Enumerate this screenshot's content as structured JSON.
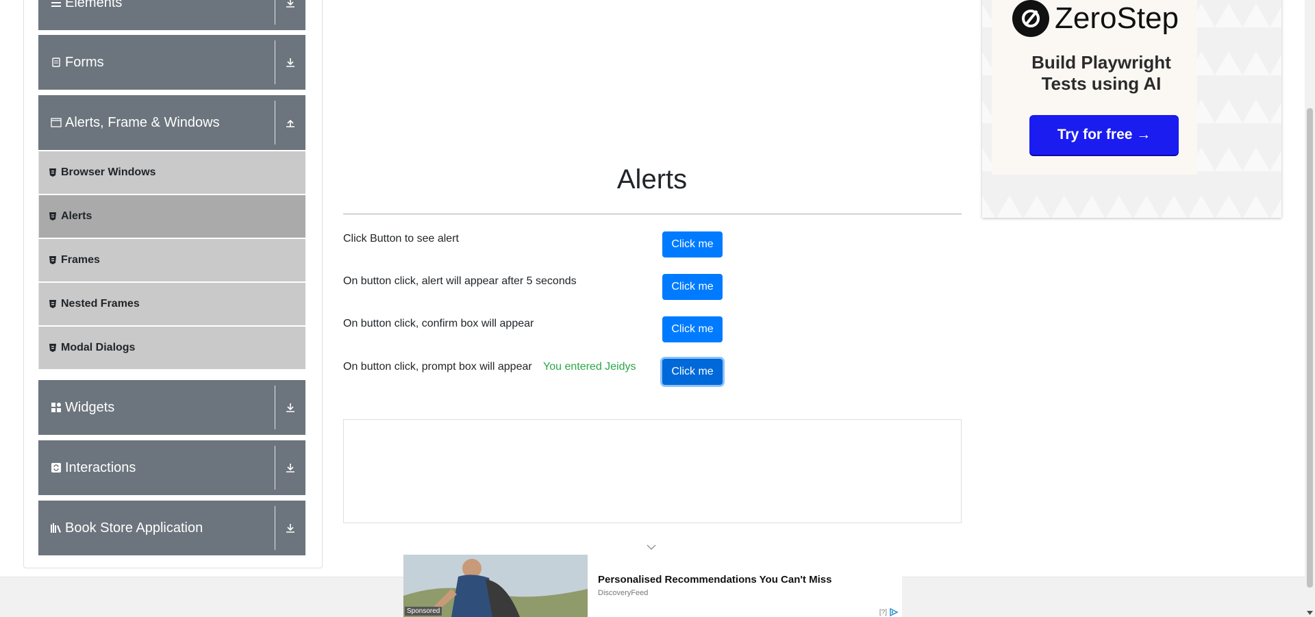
{
  "sidebar": {
    "groups": [
      {
        "label": "Elements",
        "icon": "list-icon",
        "arrow": "down"
      },
      {
        "label": "Forms",
        "icon": "document-icon",
        "arrow": "down"
      },
      {
        "label": "Alerts, Frame & Windows",
        "icon": "window-icon",
        "arrow": "up"
      },
      {
        "label": "Widgets",
        "icon": "grid-icon",
        "arrow": "down"
      },
      {
        "label": "Interactions",
        "icon": "refresh-icon",
        "arrow": "down"
      },
      {
        "label": "Book Store Application",
        "icon": "books-icon",
        "arrow": "down"
      }
    ],
    "items": [
      {
        "label": "Browser Windows"
      },
      {
        "label": "Alerts"
      },
      {
        "label": "Frames"
      },
      {
        "label": "Nested Frames"
      },
      {
        "label": "Modal Dialogs"
      }
    ],
    "active_item": "Alerts"
  },
  "main": {
    "title": "Alerts",
    "rows": [
      {
        "label": "Click Button to see alert",
        "button": "Click me"
      },
      {
        "label": "On button click, alert will appear after 5 seconds",
        "button": "Click me"
      },
      {
        "label": "On button click, confirm box will appear",
        "button": "Click me"
      },
      {
        "label": "On button click, prompt box will appear",
        "button": "Click me",
        "result": "You entered Jeidys"
      }
    ]
  },
  "ad_right": {
    "brand": "ZeroStep",
    "tagline": "Build Playwright Tests using AI",
    "cta": "Try for free →",
    "cta_color": "#1a1cf0"
  },
  "ad_bottom": {
    "title": "Personalised Recommendations You Can't Miss",
    "source": "DiscoveryFeed",
    "sponsored": "Sponsored",
    "help": "[?]"
  },
  "colors": {
    "sidebar_group": "#6c757d",
    "menu_item": "#c9c9c9",
    "menu_item_active": "#aaaaaa",
    "button": "#007bff",
    "result_text": "#28a745"
  }
}
